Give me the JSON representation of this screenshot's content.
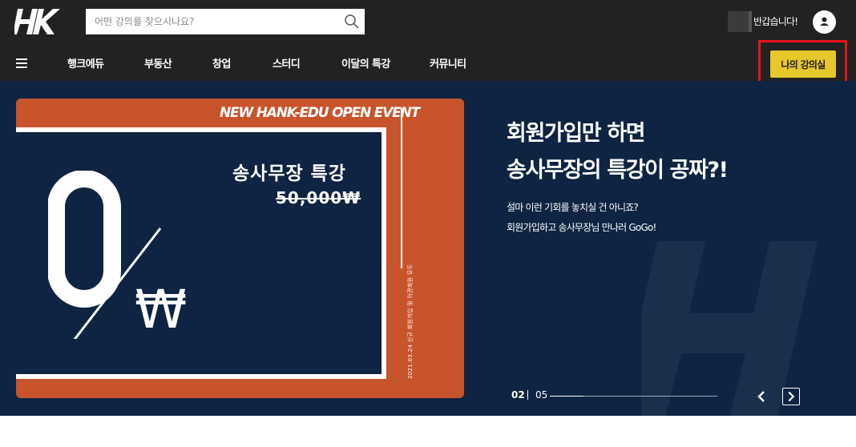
{
  "header": {
    "logo_text": "HK",
    "search": {
      "placeholder": "어떤 강의를 찾으시나요?"
    },
    "greeting": "반갑습니다!"
  },
  "nav": {
    "items": [
      "행크에듀",
      "부동산",
      "창업",
      "스터디",
      "이달의 특강",
      "커뮤니티"
    ],
    "my_class_label": "나의 강의실"
  },
  "hero": {
    "card": {
      "event": "NEW HANK-EDU OPEN EVENT",
      "title": "송사무장 특강",
      "price": "50,000₩",
      "vertical_text": "2021.03.24  신규 회원가입 및 이관회원 모두"
    },
    "heading_line1": "회원가입만 하면",
    "heading_line2": "송사무장의 특강이 공짜?!",
    "sub_line1": "설마 이런 기회를 놓치실 건 아니죠?",
    "sub_line2": "회원가입하고 송사무장님 만나러 GoGo!",
    "pager": {
      "current": "02",
      "total": "05",
      "progress": 0.2
    }
  },
  "colors": {
    "header_bg": "#222222",
    "hero_bg": "#0e2442",
    "card_orange": "#c8542c",
    "accent_yellow": "#e6c72c",
    "highlight_red": "#e8131b"
  },
  "icons": {
    "logo": "hk-logo-icon",
    "search": "search-icon",
    "avatar": "user-icon",
    "menu": "hamburger-icon",
    "prev": "chevron-left-icon",
    "next": "chevron-right-icon"
  }
}
